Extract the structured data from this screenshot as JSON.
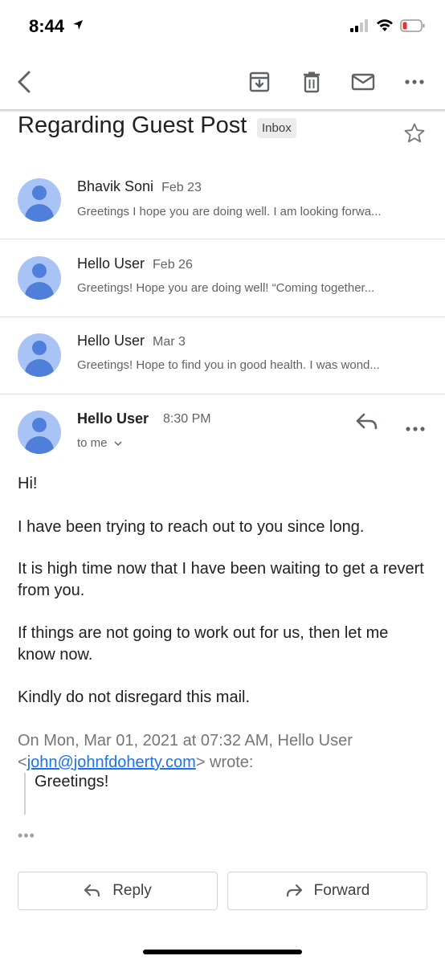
{
  "status_bar": {
    "time": "8:44"
  },
  "toolbar": {
    "icons": [
      "back-arrow-icon",
      "archive-icon",
      "trash-icon",
      "mail-icon",
      "more-horizontal-icon"
    ]
  },
  "subject": {
    "title": "Regarding Guest Post",
    "label": "Inbox"
  },
  "threads": [
    {
      "sender": "Bhavik Soni",
      "date": "Feb 23",
      "snippet": "Greetings I hope you are doing well. I am looking forwa..."
    },
    {
      "sender": "Hello User",
      "date": "Feb 26",
      "snippet": "Greetings! Hope you are doing well! “Coming together..."
    },
    {
      "sender": "Hello User",
      "date": "Mar 3",
      "snippet": "Greetings! Hope to find you in good health. I was wond..."
    }
  ],
  "open_message": {
    "sender": "Hello User",
    "time": "8:30 PM",
    "recipient": "to me",
    "body": [
      "Hi!",
      "I have been trying to reach out to you since long.",
      "It is high time now that I have been waiting to get a revert from you.",
      "If things are not going to work out for us, then let me know now.",
      "Kindly do not disregard this mail."
    ],
    "quote_intro": "On Mon, Mar 01, 2021 at 07:32 AM, Hello User",
    "quote_email": "john@johnfdoherty.com",
    "quote_wrote": "wrote:",
    "quoted_text": "Greetings!",
    "trimmed": "•••"
  },
  "actions": {
    "reply_label": "Reply",
    "forward_label": "Forward"
  },
  "colors": {
    "avatar_bg": "#a8c4f5",
    "avatar_fg": "#4f7fdb",
    "link": "#1a73e8"
  }
}
